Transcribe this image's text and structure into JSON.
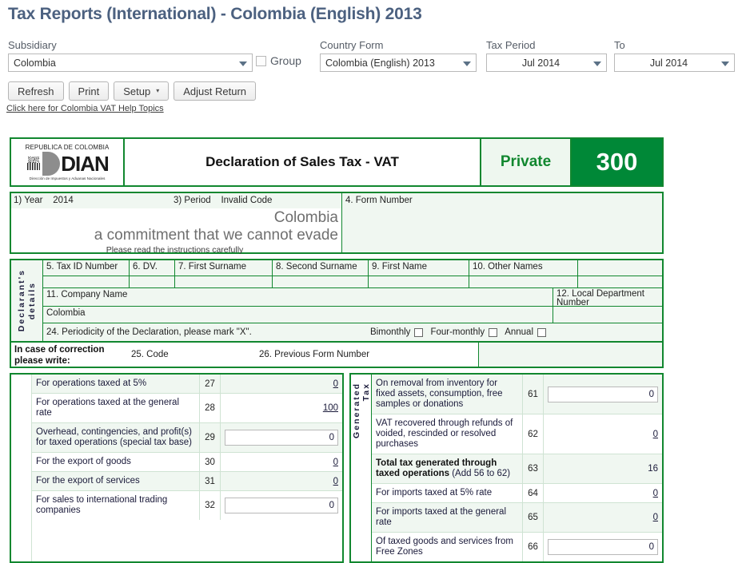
{
  "page_title": "Tax Reports (International) - Colombia (English) 2013",
  "filters": {
    "subsidiary": {
      "label": "Subsidiary",
      "value": "Colombia"
    },
    "group": {
      "label": "Group",
      "checked": false
    },
    "country_form": {
      "label": "Country Form",
      "value": "Colombia (English) 2013"
    },
    "tax_period": {
      "label": "Tax Period",
      "value": "Jul 2014"
    },
    "to": {
      "label": "To",
      "value": "Jul 2014"
    }
  },
  "toolbar": {
    "refresh": "Refresh",
    "print": "Print",
    "setup": "Setup",
    "setup_caret": "▾",
    "adjust_return": "Adjust Return"
  },
  "help_link": "Click here for Colombia VAT Help Topics",
  "form": {
    "logo": {
      "top": "REPUBLICA DE COLOMBIA",
      "name": "DIAN",
      "sub": "Dirección de Impuestos y Aduanas Nacionales"
    },
    "title": "Declaration of Sales Tax - VAT",
    "private": "Private",
    "number": "300",
    "year_label": "1) Year",
    "year_value": "2014",
    "period_label": "3) Period",
    "period_value": "Invalid Code",
    "slogan_line1": "Colombia",
    "slogan_line2": "a commitment that we cannot evade",
    "slogan_line3": "Please read the instructions carefully",
    "form_number_label": "4. Form Number",
    "declarant_vertical_1": "Declarant's",
    "declarant_vertical_2": "details",
    "headers": {
      "tax_id": "5. Tax ID Number",
      "dv": "6. DV.",
      "first_surname": "7. First Surname",
      "second_surname": "8. Second Surname",
      "first_name": "9. First Name",
      "other_names": "10. Other Names"
    },
    "company_name_label": "11. Company Name",
    "company_name_value": "Colombia",
    "local_dept_label": "12. Local Department Number",
    "periodicity_label": "24. Periodicity of the Declaration, please mark \"X\".",
    "periodicity_options": [
      "Bimonthly",
      "Four-monthly",
      "Annual"
    ],
    "correction_label": "In case of correction please write:",
    "code_label": "25. Code",
    "previous_form_label": "26. Previous Form Number",
    "generated_tax_vertical_1": "Generated",
    "generated_tax_vertical_2": "Tax"
  },
  "left_table": {
    "rows": [
      {
        "desc": "For operations taxed at 5%",
        "num": "27",
        "value": "0",
        "type": "link",
        "alt": true
      },
      {
        "desc": "For operations taxed at the general rate",
        "num": "28",
        "value": "100",
        "type": "link",
        "alt": false
      },
      {
        "desc": "Overhead, contingencies, and profit(s) for taxed operations (special tax base)",
        "num": "29",
        "value": "0",
        "type": "input",
        "alt": true
      },
      {
        "desc": "For the export of goods",
        "num": "30",
        "value": "0",
        "type": "link",
        "alt": false
      },
      {
        "desc": "For the export of services",
        "num": "31",
        "value": "0",
        "type": "link",
        "alt": true
      },
      {
        "desc": "For sales to international trading companies",
        "num": "32",
        "value": "0",
        "type": "input",
        "alt": false
      }
    ]
  },
  "right_table": {
    "rows": [
      {
        "desc": "On removal from inventory for fixed assets, consumption, free samples or donations",
        "num": "61",
        "value": "0",
        "type": "input",
        "alt": true,
        "bold": false
      },
      {
        "desc": "VAT recovered through refunds of voided, rescinded or resolved purchases",
        "num": "62",
        "value": "0",
        "type": "link",
        "alt": false,
        "bold": false
      },
      {
        "desc": "Total tax generated through taxed operations",
        "desc_suffix": " (Add 56 to 62)",
        "num": "63",
        "value": "16",
        "type": "text",
        "alt": true,
        "bold": true
      },
      {
        "desc": "For imports taxed at 5% rate",
        "num": "64",
        "value": "0",
        "type": "link",
        "alt": false,
        "bold": false
      },
      {
        "desc": "For imports taxed at the general rate",
        "num": "65",
        "value": "0",
        "type": "link",
        "alt": true,
        "bold": false
      },
      {
        "desc": "Of taxed goods and services from Free Zones",
        "num": "66",
        "value": "0",
        "type": "input",
        "alt": false,
        "bold": false
      }
    ]
  },
  "colors": {
    "title": "#4c6180",
    "form_green": "#11872f",
    "number_badge": "#008837",
    "row_alt": "#f0f7f1"
  }
}
